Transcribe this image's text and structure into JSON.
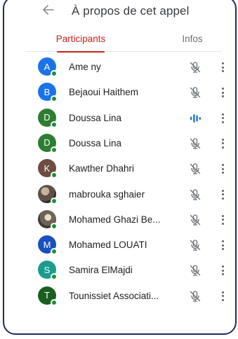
{
  "header": {
    "back_icon": "arrow-left-icon",
    "title": "À propos de cet appel"
  },
  "tabs": [
    {
      "label": "Participants",
      "active": true
    },
    {
      "label": "Infos",
      "active": false
    }
  ],
  "colors": {
    "accent": "#c5221f",
    "presence": "#1e8e3e",
    "speaking": "#1a73e8",
    "frame": "#1f2a66"
  },
  "participants": [
    {
      "initial": "A",
      "name": "Ame ny",
      "avatar_color": "#1a73e8",
      "mic": "mic-off-icon"
    },
    {
      "initial": "B",
      "name": "Bejaoui Haithem",
      "avatar_color": "#1a73e8",
      "mic": "mic-off-icon"
    },
    {
      "initial": "D",
      "name": "Doussa Lina",
      "avatar_color": "#2e7d32",
      "mic": "speaking-icon"
    },
    {
      "initial": "D",
      "name": "Doussa Lina",
      "avatar_color": "#2e7d32",
      "mic": "mic-off-icon"
    },
    {
      "initial": "K",
      "name": "Kawther Dhahri",
      "avatar_color": "#6d4c41",
      "mic": "mic-off-icon"
    },
    {
      "initial": "",
      "name": "mabrouka sghaier",
      "avatar_color": "photo",
      "mic": "mic-off-icon"
    },
    {
      "initial": "",
      "name": "Mohamed Ghazi Be...",
      "avatar_color": "photo2",
      "mic": "mic-off-icon"
    },
    {
      "initial": "M",
      "name": "Mohamed LOUATI",
      "avatar_color": "#1a4fbf",
      "mic": "mic-off-icon"
    },
    {
      "initial": "S",
      "name": "Samira ElMajdi",
      "avatar_color": "#1a9c8c",
      "mic": "mic-off-icon"
    },
    {
      "initial": "T",
      "name": "Tounissiet Associati...",
      "avatar_color": "#1b5e20",
      "mic": "mic-off-icon"
    }
  ]
}
